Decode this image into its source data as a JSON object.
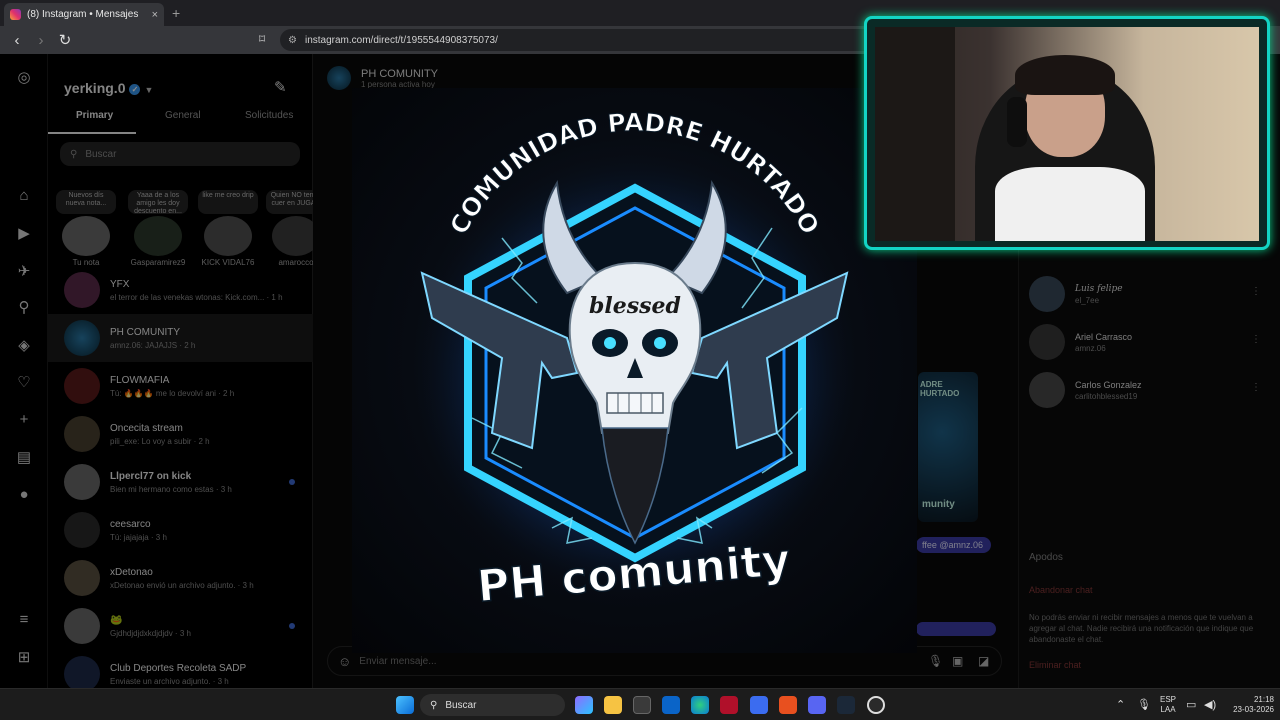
{
  "browser": {
    "tab_title": "(8) Instagram • Mensajes",
    "tab_close": "×",
    "new_tab": "+",
    "url": "instagram.com/direct/t/1955544908375073/"
  },
  "inbox": {
    "username": "yerking.0",
    "tabs": [
      "Primary",
      "General",
      "Solicitudes"
    ],
    "search_placeholder": "Buscar",
    "notes": [
      {
        "text": "Nuevos dís nueva nota...",
        "label": "Tu nota"
      },
      {
        "text": "Yaaa de a los amigo les doy descuento en...",
        "label": "Gasparamirez9"
      },
      {
        "text": "like me creo drip",
        "label": "KICK VIDAL76"
      },
      {
        "text": "Quien NO tenga cuer en JUGAR",
        "label": "amarocco"
      }
    ],
    "chats": [
      {
        "name": "YFX",
        "preview": "el terror de las venekas wtonas: Kick.com... · 1 h"
      },
      {
        "name": "PH COMUNITY",
        "preview": "amnz.06: JAJAJJS · 2 h"
      },
      {
        "name": "FLOWMAFIA",
        "preview": "Tú: 🔥🔥🔥 me lo devolví ani · 2 h"
      },
      {
        "name": "Oncecita stream",
        "preview": "pili_exe: Lo voy a subir · 2 h"
      },
      {
        "name": "Llpercl77 on kick",
        "preview": "Bien mi hermano como estas · 3 h"
      },
      {
        "name": "ceesarco",
        "preview": "Tú: jajajaja · 3 h"
      },
      {
        "name": "xDetonao",
        "preview": "xDetonao envió un archivo adjunto. · 3 h"
      },
      {
        "name": "🐸",
        "preview": "Gjdhdjdjdxkdjdjdv · 3 h"
      },
      {
        "name": "Club Deportes Recoleta SADP",
        "preview": "Enviaste un archivo adjunto. · 3 h"
      }
    ]
  },
  "conversation": {
    "title": "PH COMUNITY",
    "subtitle": "1 persona activa hoy",
    "message_placeholder": "Enviar mensaje...",
    "mini_top": "ADRE HURTADO",
    "mini_bottom": "munity",
    "mention": "ffee @amnz.06"
  },
  "details": {
    "members": [
      {
        "name": "Luis felipe",
        "handle": "el_7ee"
      },
      {
        "name": "Ariel Carrasco",
        "handle": "amnz.06"
      },
      {
        "name": "Carlos Gonzalez",
        "handle": "carlitohblessed19"
      }
    ],
    "apodos": "Apodos",
    "leave": "Abandonar chat",
    "leave_desc": "No podrás enviar ni recibir mensajes a menos que te vuelvan a agregar al chat. Nadie recibirá una notificación que indique que abandonaste el chat.",
    "delete": "Eliminar chat"
  },
  "logo": {
    "top_text": "COMUNIDAD PADRE HURTADO",
    "skull_text": "blessed",
    "bottom_text": "PH comunity"
  },
  "taskbar": {
    "search": "Buscar",
    "lang1": "ESP",
    "lang2": "LAA",
    "time": "21:18",
    "date": "23-03-2026"
  },
  "colors": {
    "accent_blue": "#3897f0",
    "webcam_border": "#13d4c4",
    "glow": "#3ec8ff"
  }
}
